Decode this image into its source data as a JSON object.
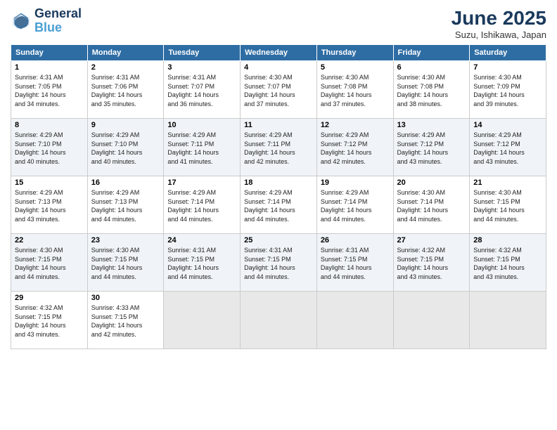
{
  "header": {
    "logo_line1": "General",
    "logo_line2": "Blue",
    "month": "June 2025",
    "location": "Suzu, Ishikawa, Japan"
  },
  "weekdays": [
    "Sunday",
    "Monday",
    "Tuesday",
    "Wednesday",
    "Thursday",
    "Friday",
    "Saturday"
  ],
  "weeks": [
    [
      {
        "day": "1",
        "info": "Sunrise: 4:31 AM\nSunset: 7:05 PM\nDaylight: 14 hours\nand 34 minutes."
      },
      {
        "day": "2",
        "info": "Sunrise: 4:31 AM\nSunset: 7:06 PM\nDaylight: 14 hours\nand 35 minutes."
      },
      {
        "day": "3",
        "info": "Sunrise: 4:31 AM\nSunset: 7:07 PM\nDaylight: 14 hours\nand 36 minutes."
      },
      {
        "day": "4",
        "info": "Sunrise: 4:30 AM\nSunset: 7:07 PM\nDaylight: 14 hours\nand 37 minutes."
      },
      {
        "day": "5",
        "info": "Sunrise: 4:30 AM\nSunset: 7:08 PM\nDaylight: 14 hours\nand 37 minutes."
      },
      {
        "day": "6",
        "info": "Sunrise: 4:30 AM\nSunset: 7:08 PM\nDaylight: 14 hours\nand 38 minutes."
      },
      {
        "day": "7",
        "info": "Sunrise: 4:30 AM\nSunset: 7:09 PM\nDaylight: 14 hours\nand 39 minutes."
      }
    ],
    [
      {
        "day": "8",
        "info": "Sunrise: 4:29 AM\nSunset: 7:10 PM\nDaylight: 14 hours\nand 40 minutes."
      },
      {
        "day": "9",
        "info": "Sunrise: 4:29 AM\nSunset: 7:10 PM\nDaylight: 14 hours\nand 40 minutes."
      },
      {
        "day": "10",
        "info": "Sunrise: 4:29 AM\nSunset: 7:11 PM\nDaylight: 14 hours\nand 41 minutes."
      },
      {
        "day": "11",
        "info": "Sunrise: 4:29 AM\nSunset: 7:11 PM\nDaylight: 14 hours\nand 42 minutes."
      },
      {
        "day": "12",
        "info": "Sunrise: 4:29 AM\nSunset: 7:12 PM\nDaylight: 14 hours\nand 42 minutes."
      },
      {
        "day": "13",
        "info": "Sunrise: 4:29 AM\nSunset: 7:12 PM\nDaylight: 14 hours\nand 43 minutes."
      },
      {
        "day": "14",
        "info": "Sunrise: 4:29 AM\nSunset: 7:12 PM\nDaylight: 14 hours\nand 43 minutes."
      }
    ],
    [
      {
        "day": "15",
        "info": "Sunrise: 4:29 AM\nSunset: 7:13 PM\nDaylight: 14 hours\nand 43 minutes."
      },
      {
        "day": "16",
        "info": "Sunrise: 4:29 AM\nSunset: 7:13 PM\nDaylight: 14 hours\nand 44 minutes."
      },
      {
        "day": "17",
        "info": "Sunrise: 4:29 AM\nSunset: 7:14 PM\nDaylight: 14 hours\nand 44 minutes."
      },
      {
        "day": "18",
        "info": "Sunrise: 4:29 AM\nSunset: 7:14 PM\nDaylight: 14 hours\nand 44 minutes."
      },
      {
        "day": "19",
        "info": "Sunrise: 4:29 AM\nSunset: 7:14 PM\nDaylight: 14 hours\nand 44 minutes."
      },
      {
        "day": "20",
        "info": "Sunrise: 4:30 AM\nSunset: 7:14 PM\nDaylight: 14 hours\nand 44 minutes."
      },
      {
        "day": "21",
        "info": "Sunrise: 4:30 AM\nSunset: 7:15 PM\nDaylight: 14 hours\nand 44 minutes."
      }
    ],
    [
      {
        "day": "22",
        "info": "Sunrise: 4:30 AM\nSunset: 7:15 PM\nDaylight: 14 hours\nand 44 minutes."
      },
      {
        "day": "23",
        "info": "Sunrise: 4:30 AM\nSunset: 7:15 PM\nDaylight: 14 hours\nand 44 minutes."
      },
      {
        "day": "24",
        "info": "Sunrise: 4:31 AM\nSunset: 7:15 PM\nDaylight: 14 hours\nand 44 minutes."
      },
      {
        "day": "25",
        "info": "Sunrise: 4:31 AM\nSunset: 7:15 PM\nDaylight: 14 hours\nand 44 minutes."
      },
      {
        "day": "26",
        "info": "Sunrise: 4:31 AM\nSunset: 7:15 PM\nDaylight: 14 hours\nand 44 minutes."
      },
      {
        "day": "27",
        "info": "Sunrise: 4:32 AM\nSunset: 7:15 PM\nDaylight: 14 hours\nand 43 minutes."
      },
      {
        "day": "28",
        "info": "Sunrise: 4:32 AM\nSunset: 7:15 PM\nDaylight: 14 hours\nand 43 minutes."
      }
    ],
    [
      {
        "day": "29",
        "info": "Sunrise: 4:32 AM\nSunset: 7:15 PM\nDaylight: 14 hours\nand 43 minutes."
      },
      {
        "day": "30",
        "info": "Sunrise: 4:33 AM\nSunset: 7:15 PM\nDaylight: 14 hours\nand 42 minutes."
      },
      {
        "day": "",
        "info": ""
      },
      {
        "day": "",
        "info": ""
      },
      {
        "day": "",
        "info": ""
      },
      {
        "day": "",
        "info": ""
      },
      {
        "day": "",
        "info": ""
      }
    ]
  ]
}
